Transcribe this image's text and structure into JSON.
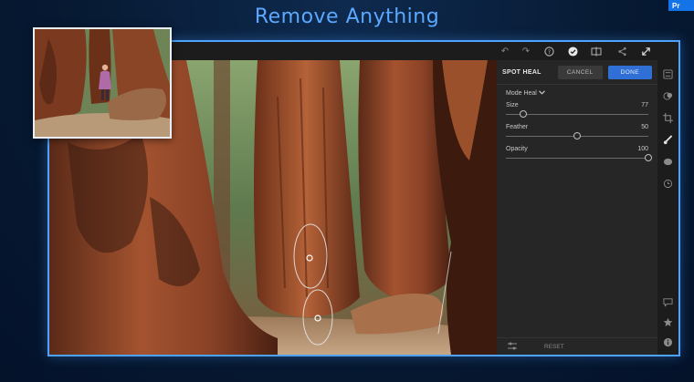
{
  "headline": "Remove Anything",
  "corner_tag": "Pr",
  "toolbar": {
    "icons": [
      "undo-icon",
      "redo-icon",
      "help-icon",
      "check-badge-icon",
      "compare-icon",
      "share-icon",
      "fullscreen-icon"
    ]
  },
  "panel": {
    "title": "SPOT HEAL",
    "cancel_label": "CANCEL",
    "done_label": "DONE",
    "mode_label": "Mode Heal",
    "sliders": [
      {
        "label": "Size",
        "value": "77",
        "level": 0.12
      },
      {
        "label": "Feather",
        "value": "50",
        "level": 0.5
      },
      {
        "label": "Opacity",
        "value": "100",
        "level": 1.0
      }
    ],
    "reset_label": "RESET"
  },
  "rail_icons": [
    "sliders-icon",
    "color-icon",
    "crop-icon",
    "brush-icon",
    "circle-mask-icon",
    "history-icon",
    "comment-icon",
    "star-icon",
    "info-icon"
  ],
  "colors": {
    "accent": "#4da3ff",
    "headline": "#5aa8ff",
    "done_button": "#2f6fd6",
    "panel_bg": "#262626"
  }
}
